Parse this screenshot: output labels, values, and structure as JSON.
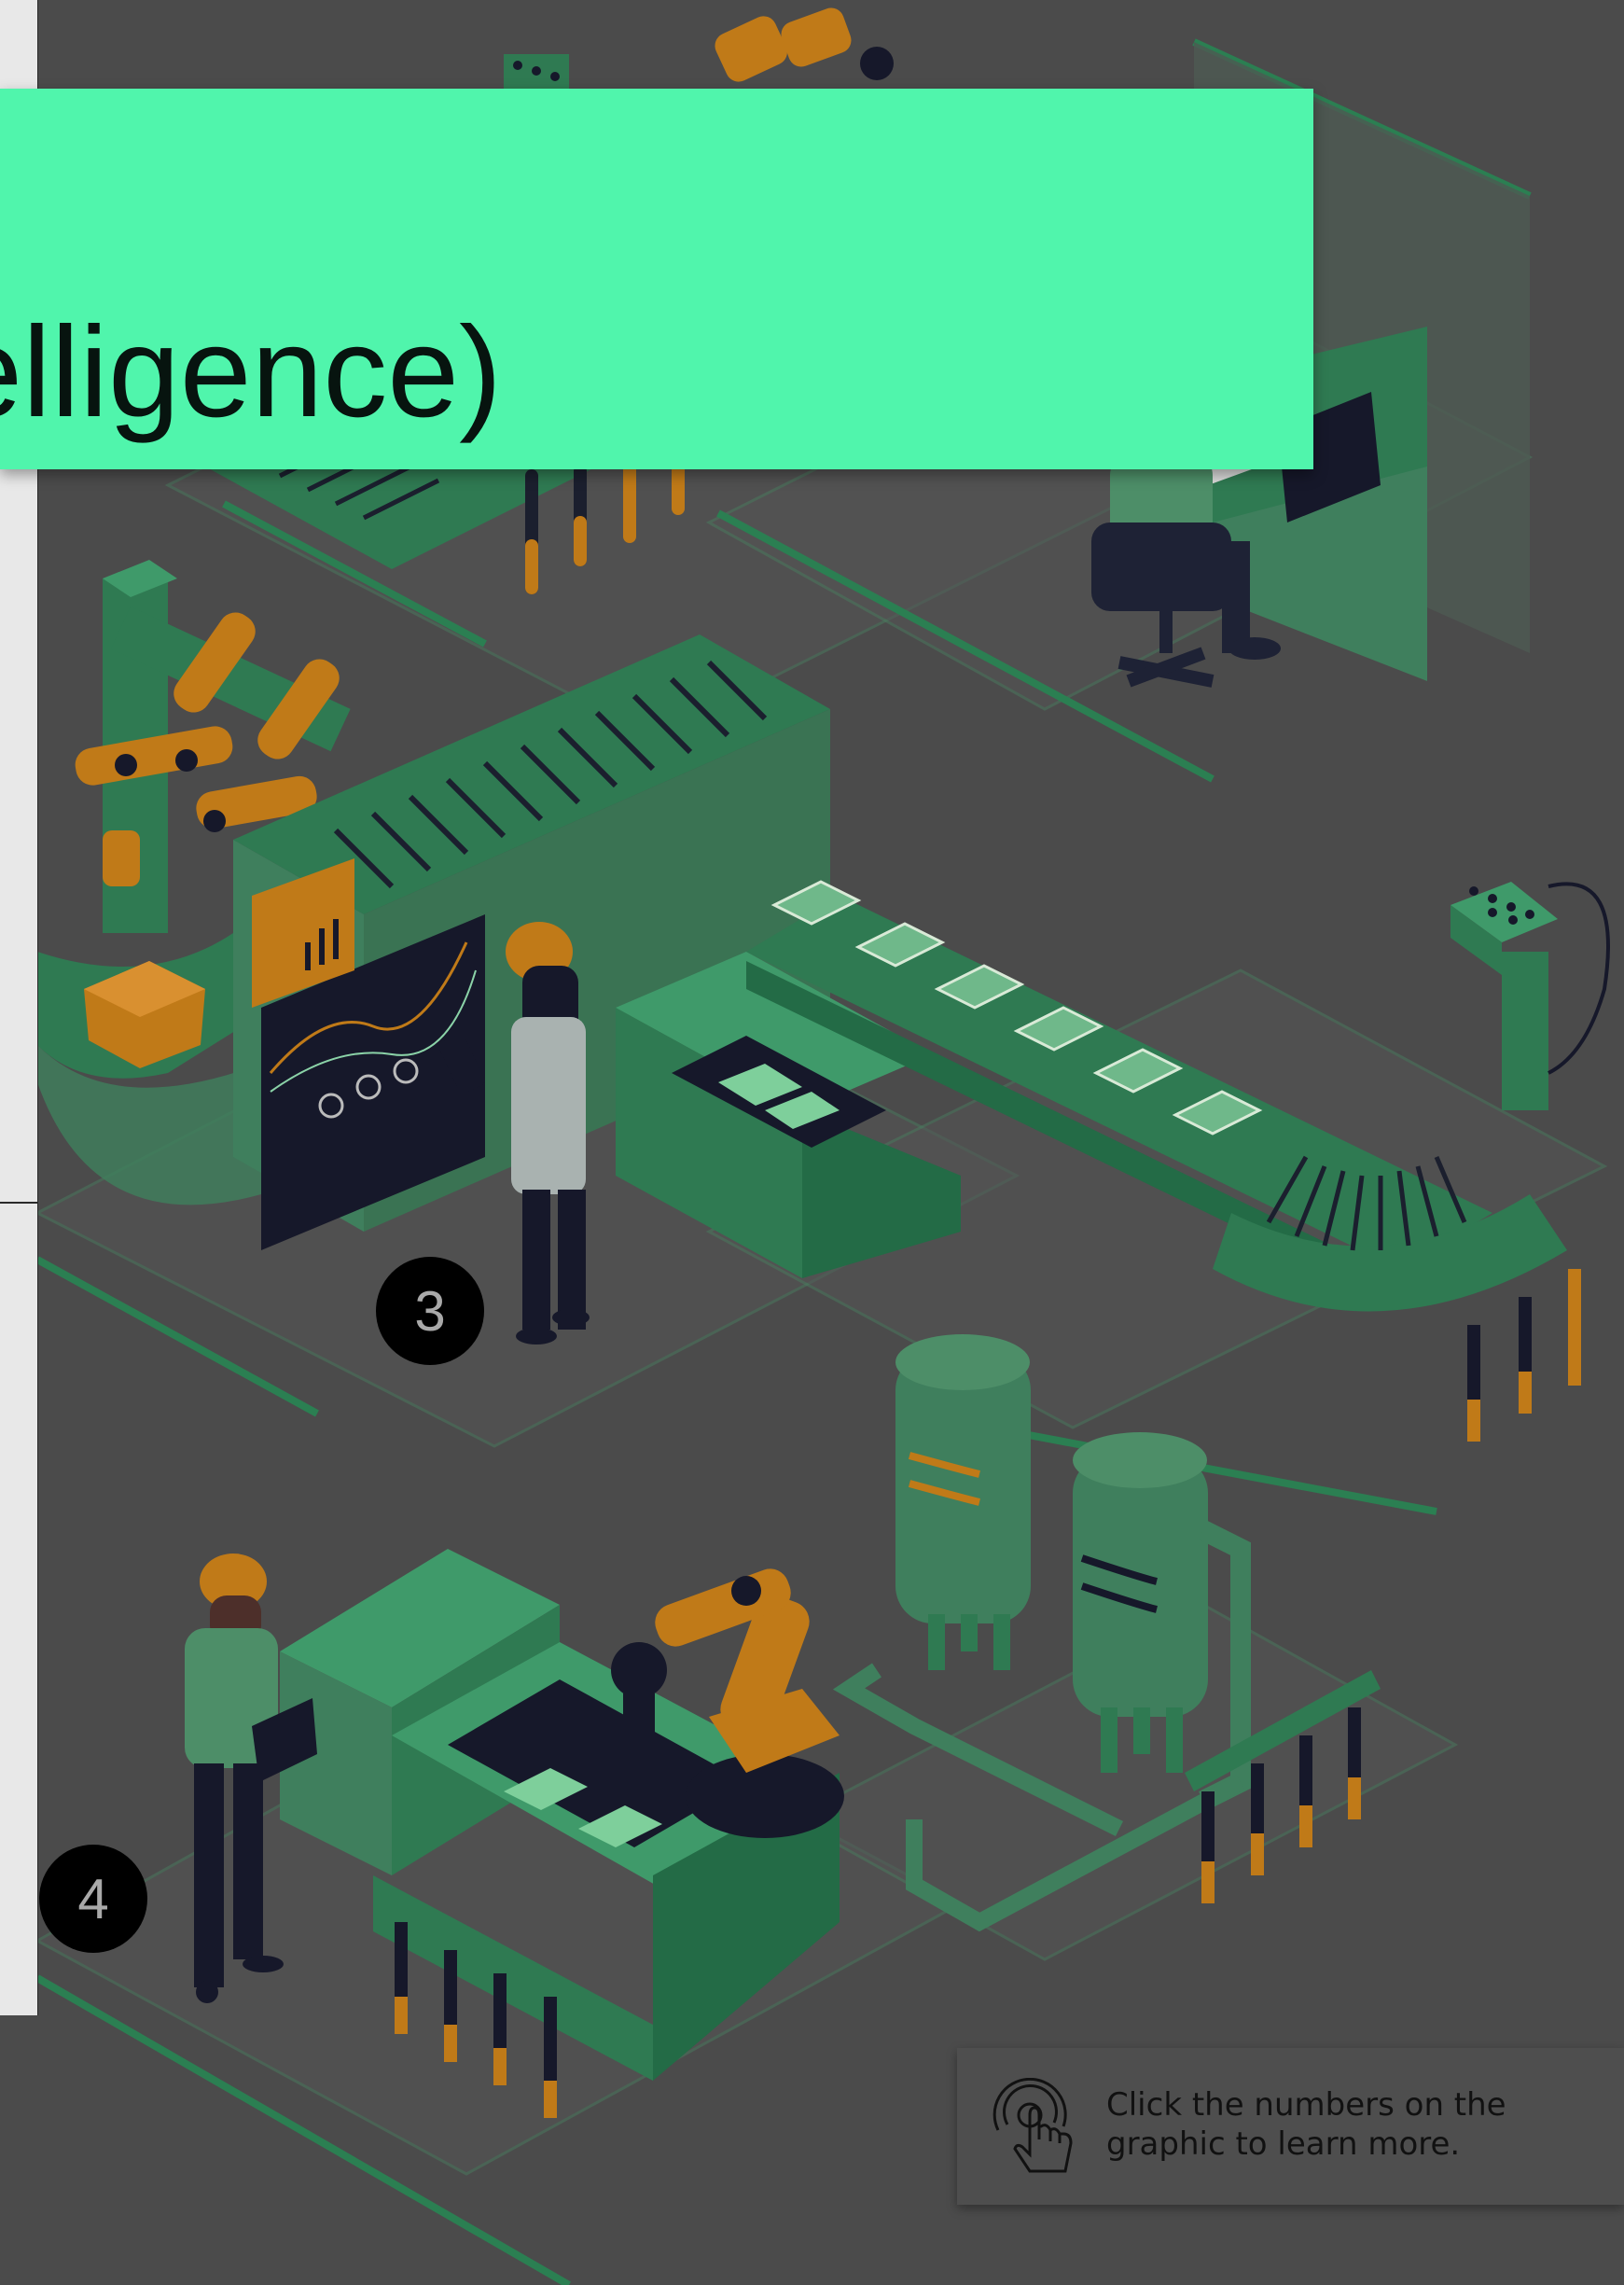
{
  "banner": {
    "title_fragment": "elligence)"
  },
  "hotspots": [
    {
      "label": "3"
    },
    {
      "label": "4"
    }
  ],
  "hint": {
    "text": "Click the numbers on the graphic to learn more.",
    "icon": "tap-hand-icon"
  },
  "colors": {
    "background": "#4b4b4b",
    "banner": "#50f5ac",
    "machine_green": "#2f7a52",
    "accent_orange": "#c07a18",
    "dark_navy": "#16182a"
  }
}
